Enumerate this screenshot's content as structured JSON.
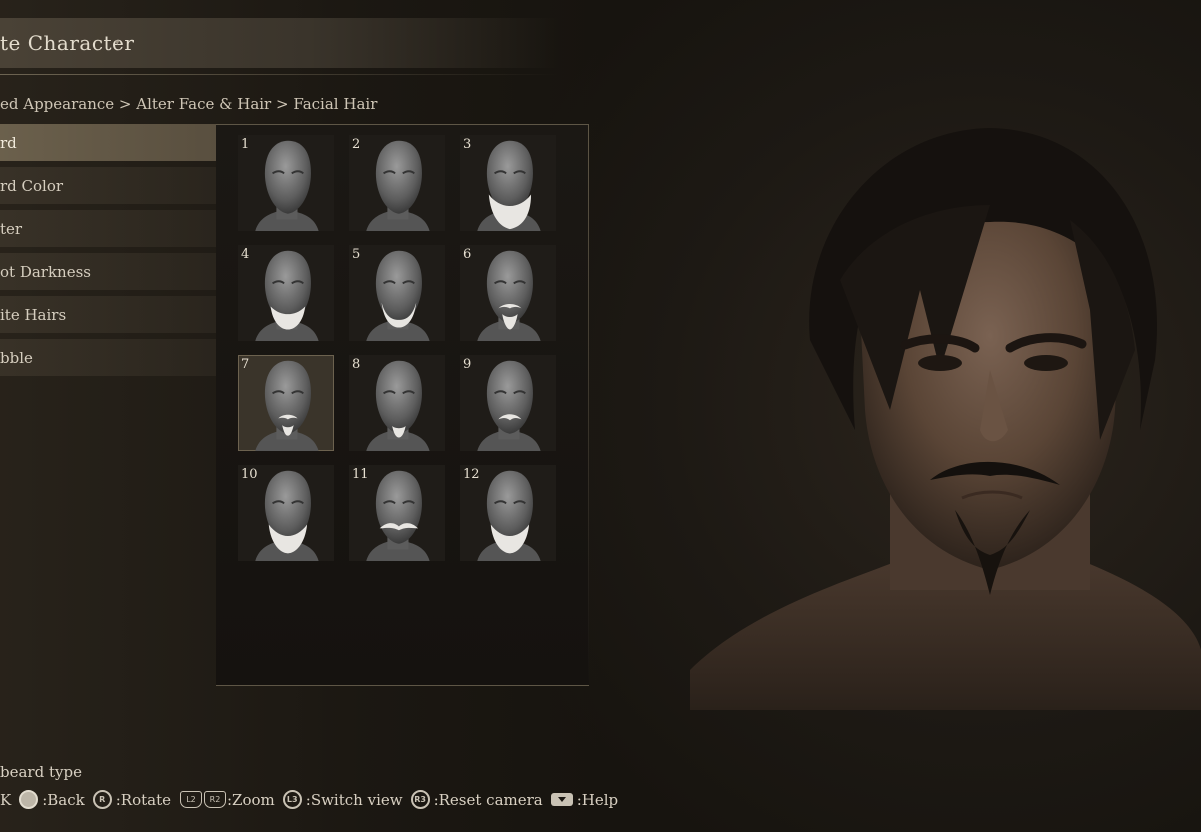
{
  "header": {
    "title": "te Character",
    "title_caret": "▾"
  },
  "breadcrumb": "ed Appearance > Alter Face & Hair > Facial Hair",
  "menu": {
    "items": [
      {
        "label": "rd",
        "selected": true
      },
      {
        "label": "rd Color",
        "selected": false
      },
      {
        "label": "ter",
        "selected": false
      },
      {
        "label": "ot Darkness",
        "selected": false
      },
      {
        "label": "ite Hairs",
        "selected": false
      },
      {
        "label": "bble",
        "selected": false
      }
    ]
  },
  "beard_grid": {
    "selected_index": 7,
    "options": [
      {
        "number": "1",
        "beard": "none"
      },
      {
        "number": "2",
        "beard": "none"
      },
      {
        "number": "3",
        "beard": "full-long"
      },
      {
        "number": "4",
        "beard": "short-full"
      },
      {
        "number": "5",
        "beard": "chin-strap"
      },
      {
        "number": "6",
        "beard": "mustache-goatee"
      },
      {
        "number": "7",
        "beard": "mustache-goatee-small"
      },
      {
        "number": "8",
        "beard": "chin-goatee"
      },
      {
        "number": "9",
        "beard": "mustache"
      },
      {
        "number": "10",
        "beard": "full-medium"
      },
      {
        "number": "11",
        "beard": "handlebar"
      },
      {
        "number": "12",
        "beard": "full-medium"
      }
    ]
  },
  "footer": {
    "help": "beard type",
    "controls": [
      {
        "button_icon": "",
        "label": "K",
        "icon_kind": "none"
      },
      {
        "button_icon": "",
        "label": ":Back",
        "icon_kind": "circle-filled"
      },
      {
        "button_icon": "R",
        "label": ":Rotate",
        "icon_kind": "circle-outline"
      },
      {
        "button_icon": "L2",
        "label": "",
        "icon_kind": "trigger"
      },
      {
        "button_icon": "R2",
        "label": ":Zoom",
        "icon_kind": "trigger"
      },
      {
        "button_icon": "L3",
        "label": ":Switch view",
        "icon_kind": "circle-outline"
      },
      {
        "button_icon": "R3",
        "label": ":Reset camera",
        "icon_kind": "circle-outline"
      },
      {
        "button_icon": "",
        "label": ":Help",
        "icon_kind": "touchpad"
      }
    ]
  },
  "colors": {
    "accent": "#6b604c",
    "text": "#d8d0c2",
    "background": "#1c1813"
  }
}
